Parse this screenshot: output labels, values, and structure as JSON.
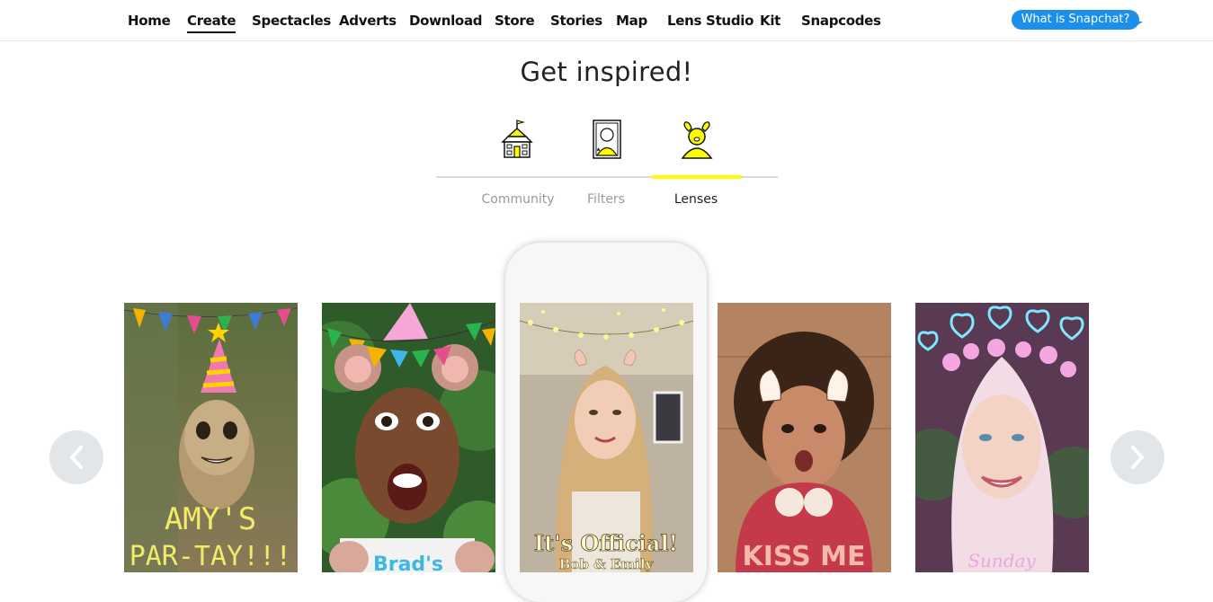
{
  "nav": {
    "items": [
      {
        "label": "Home",
        "active": false
      },
      {
        "label": "Create",
        "active": true
      },
      {
        "label": "Spectacles",
        "active": false
      },
      {
        "label": "Adverts",
        "active": false
      },
      {
        "label": "Download",
        "active": false
      },
      {
        "label": "Store",
        "active": false
      },
      {
        "label": "Stories",
        "active": false
      },
      {
        "label": "Map",
        "active": false
      },
      {
        "label": "Lens Studio",
        "active": false
      },
      {
        "label": "Kit",
        "active": false
      },
      {
        "label": "Snapcodes",
        "active": false
      }
    ],
    "cta_label": "What is Snapchat?",
    "cta_color": "#1b8fea"
  },
  "heading": "Get inspired!",
  "tabs": [
    {
      "label": "Community",
      "icon": "schoolhouse-icon",
      "active": false
    },
    {
      "label": "Filters",
      "icon": "portrait-frame-icon",
      "active": false
    },
    {
      "label": "Lenses",
      "icon": "puppy-lens-icon",
      "active": true
    }
  ],
  "accent_yellow": "#fffc00",
  "carousel": {
    "cards": [
      {
        "name": "meerkat-party-lens",
        "caption": "AMY'S\nPAR-TAY!!!"
      },
      {
        "name": "party-bear-ears-lens",
        "caption": "Brad's"
      },
      {
        "name": "wedding-official-lens",
        "caption": "It's Official!\nBob & Emily"
      },
      {
        "name": "kiss-me-puppy-lens",
        "caption": "KISS ME"
      },
      {
        "name": "hearts-flowers-lens",
        "caption": "Sunday"
      }
    ],
    "prev_icon": "chevron-left-icon",
    "next_icon": "chevron-right-icon"
  }
}
